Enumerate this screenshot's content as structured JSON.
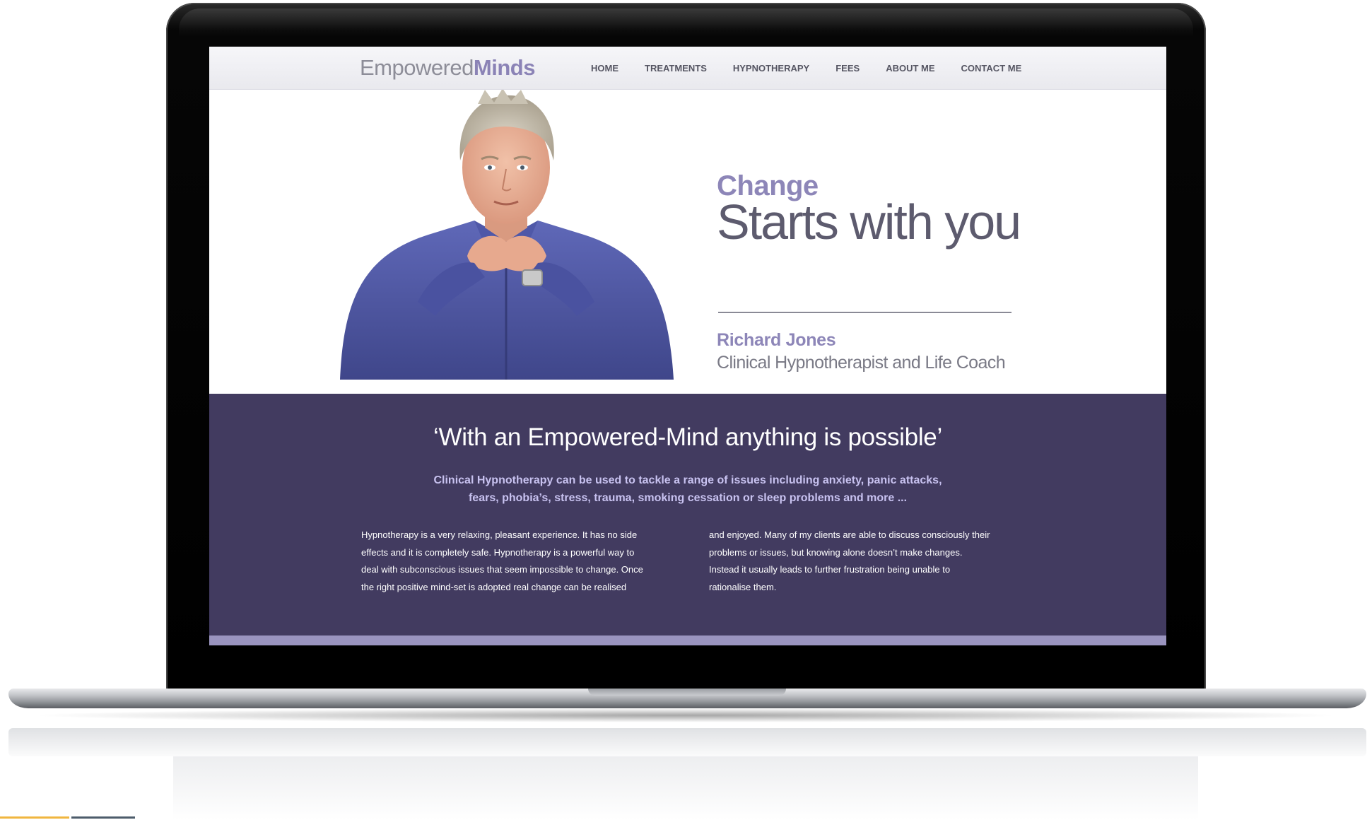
{
  "site": {
    "logo_light": "Empowered",
    "logo_bold": "Minds"
  },
  "nav": {
    "items": [
      {
        "label": "HOME"
      },
      {
        "label": "TREATMENTS"
      },
      {
        "label": "HYPNOTHERAPY"
      },
      {
        "label": "FEES"
      },
      {
        "label": "ABOUT ME"
      },
      {
        "label": "CONTACT ME"
      }
    ]
  },
  "hero": {
    "headline_small": "Change",
    "headline_large": "Starts with you",
    "name": "Richard Jones",
    "role": "Clinical Hypnotherapist and Life Coach"
  },
  "band": {
    "quote": "‘With an Empowered-Mind anything is possible’",
    "lead_line1": "Clinical Hypnotherapy can be used to tackle a range of issues including anxiety, panic attacks,",
    "lead_line2": "fears, phobia’s, stress, trauma, smoking cessation or sleep problems and more ...",
    "col_left": [
      "Hypnotherapy is a very relaxing, pleasant experience. It has no side",
      "effects and it is completely safe. Hypnotherapy is a powerful way to",
      "deal with subconscious issues that seem impossible to change. Once",
      "the right positive mind-set is adopted real change can be realised"
    ],
    "col_right": [
      "and enjoyed. Many of my clients are able to discuss consciously their",
      "problems or issues, but knowing alone doesn’t make changes.",
      "Instead it usually leads to further frustration being unable to",
      "rationalise them."
    ]
  },
  "colors": {
    "brand_purple": "#8d86b8",
    "band_purple": "#423b60",
    "strip_purple": "#9a94bf",
    "accent_yellow": "#f0b640",
    "accent_dark": "#4d5c6b"
  }
}
